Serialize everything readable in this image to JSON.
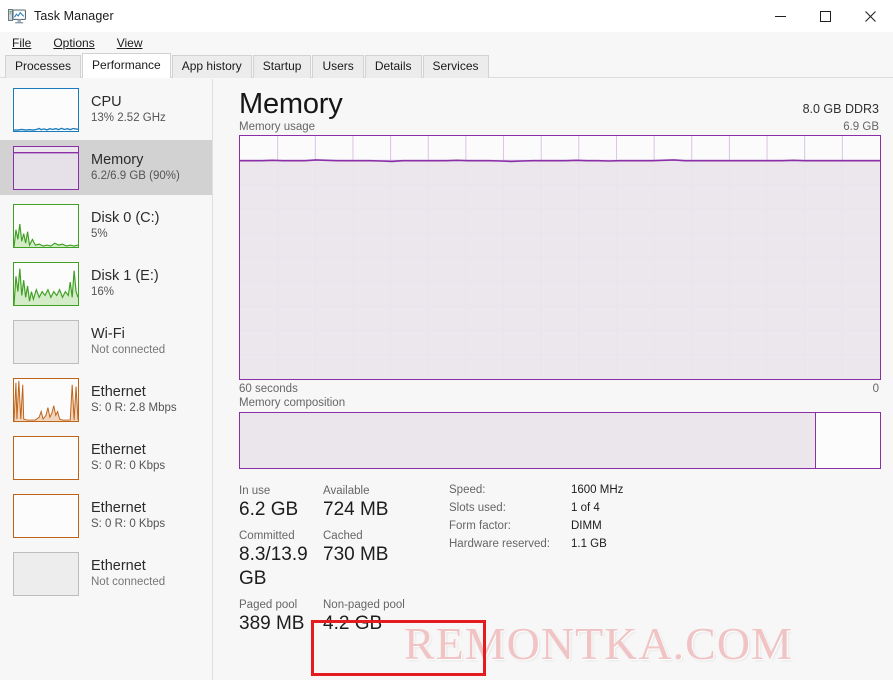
{
  "window": {
    "title": "Task Manager",
    "icon": "task-manager-icon",
    "controls": {
      "minimize": "–",
      "maximize": "□",
      "close": "✕"
    }
  },
  "menu": [
    {
      "label": "File",
      "accel": "F"
    },
    {
      "label": "Options",
      "accel": "O"
    },
    {
      "label": "View",
      "accel": "V"
    }
  ],
  "tabs": [
    {
      "label": "Processes",
      "active": false
    },
    {
      "label": "Performance",
      "active": true
    },
    {
      "label": "App history",
      "active": false
    },
    {
      "label": "Startup",
      "active": false
    },
    {
      "label": "Users",
      "active": false
    },
    {
      "label": "Details",
      "active": false
    },
    {
      "label": "Services",
      "active": false
    }
  ],
  "sidebar": {
    "items": [
      {
        "title": "CPU",
        "sub": "13%  2.52 GHz",
        "color": "#1a7bbd",
        "selected": false,
        "connected": true
      },
      {
        "title": "Memory",
        "sub": "6.2/6.9 GB (90%)",
        "color": "#8b2fa8",
        "selected": true,
        "connected": true
      },
      {
        "title": "Disk 0 (C:)",
        "sub": "5%",
        "color": "#3fa023",
        "selected": false,
        "connected": true
      },
      {
        "title": "Disk 1 (E:)",
        "sub": "16%",
        "color": "#3fa023",
        "selected": false,
        "connected": true
      },
      {
        "title": "Wi-Fi",
        "sub": "Not connected",
        "color": "#b0b0b0",
        "selected": false,
        "connected": false
      },
      {
        "title": "Ethernet",
        "sub": "S: 0  R: 2.8 Mbps",
        "color": "#bf6318",
        "selected": false,
        "connected": true
      },
      {
        "title": "Ethernet",
        "sub": "S: 0  R: 0 Kbps",
        "color": "#bf6318",
        "selected": false,
        "connected": true
      },
      {
        "title": "Ethernet",
        "sub": "S: 0  R: 0 Kbps",
        "color": "#bf6318",
        "selected": false,
        "connected": true
      },
      {
        "title": "Ethernet",
        "sub": "Not connected",
        "color": "#b0b0b0",
        "selected": false,
        "connected": false
      }
    ]
  },
  "main": {
    "title": "Memory",
    "hardware_summary": "8.0 GB DDR3",
    "graph": {
      "caption": "Memory usage",
      "y_max_label": "6.9 GB",
      "x_left_label": "60 seconds",
      "x_right_label": "0"
    },
    "composition": {
      "caption": "Memory composition",
      "in_use_percent": 90
    },
    "stats_left": [
      {
        "label": "In use",
        "value": "6.2 GB"
      },
      {
        "label": "Available",
        "value": "724 MB"
      },
      {
        "label": "Committed",
        "value": "8.3/13.9 GB"
      },
      {
        "label": "Cached",
        "value": "730 MB"
      },
      {
        "label": "Paged pool",
        "value": "389 MB"
      },
      {
        "label": "Non-paged pool",
        "value": "4.2 GB"
      }
    ],
    "stats_right": [
      {
        "label": "Speed:",
        "value": "1600 MHz"
      },
      {
        "label": "Slots used:",
        "value": "1 of 4"
      },
      {
        "label": "Form factor:",
        "value": "DIMM"
      },
      {
        "label": "Hardware reserved:",
        "value": "1.1 GB"
      }
    ]
  },
  "overlay": {
    "highlight_color": "#e41c20",
    "watermark_text": "REMONTKA.COM"
  },
  "chart_data": {
    "type": "area",
    "title": "Memory usage",
    "ylabel": "",
    "xlabel": "60 seconds",
    "ylim": [
      0,
      6.9
    ],
    "y_unit": "GB",
    "x_range_seconds": 60,
    "grid": true,
    "grid_columns": 17,
    "grid_rows": 10,
    "series": [
      {
        "name": "Memory in use",
        "color": "#8b2fa8",
        "fill": "#eae6ec",
        "values": [
          6.2,
          6.2,
          6.2,
          6.21,
          6.2,
          6.2,
          6.2,
          6.22,
          6.21,
          6.2,
          6.2,
          6.2,
          6.2,
          6.19,
          6.18,
          6.2,
          6.2,
          6.2,
          6.2,
          6.2,
          6.21,
          6.2,
          6.2,
          6.2,
          6.19,
          6.18,
          6.19,
          6.2,
          6.2,
          6.2,
          6.2,
          6.21,
          6.2,
          6.2,
          6.19,
          6.2,
          6.2,
          6.2,
          6.2,
          6.21,
          6.22,
          6.2,
          6.2,
          6.2,
          6.2,
          6.2,
          6.2,
          6.2,
          6.2,
          6.2,
          6.2,
          6.21,
          6.2,
          6.2,
          6.2,
          6.2,
          6.2,
          6.2,
          6.2,
          6.2
        ]
      }
    ]
  }
}
